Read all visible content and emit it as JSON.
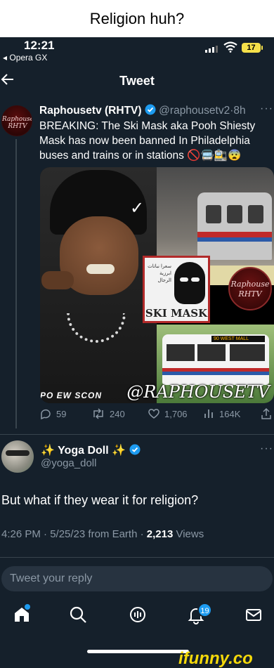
{
  "caption": "Religion huh?",
  "status_bar": {
    "time": "12:21",
    "back_app": "◂ Opera GX",
    "battery": "17"
  },
  "header": {
    "title": "Tweet"
  },
  "quoted_tweet": {
    "avatar_text_top": "Raphouse",
    "avatar_text_bottom": "RHTV",
    "name": "Raphousetv (RHTV)",
    "handle": "@raphousetv2",
    "time": "8h",
    "text": "BREAKING: The Ski Mask aka Pooh Shiesty Mask has now been banned In Philadelphia buses and trains or in stations 🚫🚍🚉😨",
    "media": {
      "ski_card_arabic": "سعرا نباتات ابرزية الرجال",
      "ski_card_label": "SKI MASK",
      "bottom_left_text": "PO EW  SCON",
      "bus_sign": "90 WEST MALL",
      "logo_top": "Raphouse",
      "logo_bottom": "RHTV",
      "watermark": "@RAPHOUSETV"
    },
    "stats": {
      "replies": "59",
      "retweets": "240",
      "likes": "1,706",
      "views": "164K"
    }
  },
  "tweet": {
    "name": "Yoga Doll",
    "sparkle": "✨",
    "handle": "@yoga_doll",
    "text": "But what if they wear it for religion?",
    "meta_date": "4:26 PM · 5/25/23 from Earth · ",
    "views_count": "2,213",
    "views_label": " Views"
  },
  "reply": {
    "placeholder": "Tweet your reply"
  },
  "tabbar": {
    "notifications_badge": "19"
  },
  "watermark": "ifunny.co",
  "colors": {
    "accent": "#1d9bf0",
    "background": "#15202b",
    "muted": "#8b98a5"
  }
}
